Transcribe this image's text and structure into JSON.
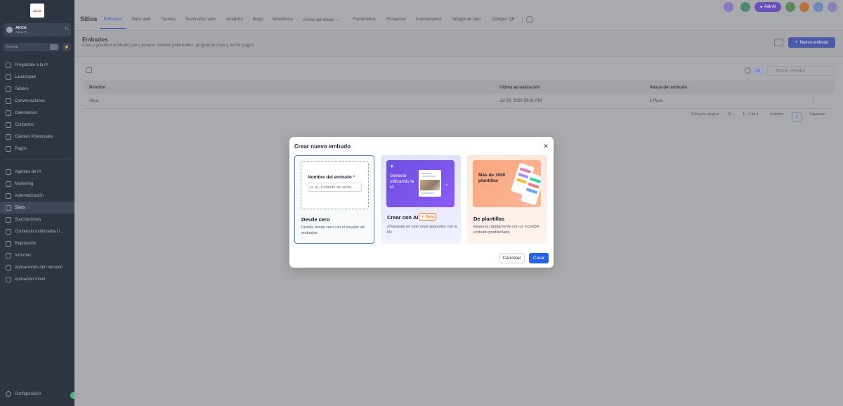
{
  "sidebar": {
    "logo_text": "AKCA",
    "account": {
      "name": "AKCA",
      "location": "Akca, FL"
    },
    "search_placeholder": "Buscar",
    "items": [
      {
        "label": "Pregúntale a la IA",
        "icon": "sparkle-icon"
      },
      {
        "label": "Launchpad",
        "icon": "rocket-icon"
      },
      {
        "label": "Tablero",
        "icon": "dashboard-icon"
      },
      {
        "label": "Conversaciones",
        "icon": "chat-icon"
      },
      {
        "label": "Calendarios",
        "icon": "calendar-icon"
      },
      {
        "label": "Contactos",
        "icon": "contacts-icon"
      },
      {
        "label": "Clientes Potenciales",
        "icon": "leads-icon"
      },
      {
        "label": "Pagos",
        "icon": "payments-icon"
      },
      {
        "label": "Agentes de IA",
        "icon": "robot-icon"
      },
      {
        "label": "Marketing",
        "icon": "megaphone-icon"
      },
      {
        "label": "Automatización",
        "icon": "automation-icon"
      },
      {
        "label": "Sitios",
        "icon": "globe-icon"
      },
      {
        "label": "Suscripciones",
        "icon": "subscription-icon"
      },
      {
        "label": "Contenido multimedia U...",
        "icon": "media-icon"
      },
      {
        "label": "Reputación",
        "icon": "star-icon"
      },
      {
        "label": "Informes",
        "icon": "chart-icon"
      },
      {
        "label": "Aplicaciones del mercado",
        "icon": "apps-icon"
      },
      {
        "label": "Aplicación móvil",
        "icon": "mobile-icon"
      }
    ],
    "settings_label": "Configuración"
  },
  "topbar": {
    "title": "Sitios",
    "tabs": [
      "Embudos",
      "Sitios web",
      "Tiendas",
      "Seminarios web",
      "Analytics",
      "Blogs",
      "WordPress",
      "Portal del cliente",
      "Formularios",
      "Encuestas",
      "Cuestionarios",
      "Widget de chat",
      "Códigos QR"
    ],
    "ask_ai": "Ask AI"
  },
  "page": {
    "title": "Embudos",
    "subtitle": "Cree y gestione embudos para generar clientes potenciales, programar citas y recibir pagos.",
    "new_button": "Nuevo embudo",
    "count": "10",
    "search_placeholder": "Buscar embudos"
  },
  "table": {
    "headers": [
      "Nombre",
      "Última actualización",
      "Pasos del embudo"
    ],
    "rows": [
      {
        "name": "Akca",
        "updated": "Jul 09, 2026 09:41 PM",
        "steps": "1 Paso"
      }
    ],
    "rows_per_page_label": "Filas por página",
    "rows_per_page": "15",
    "range": "1 - 1 de 1",
    "prev": "Anterior",
    "page": "1",
    "next": "Siguiente"
  },
  "modal": {
    "title": "Crear nuevo embudo",
    "options": [
      {
        "title": "Desde cero",
        "desc": "Diseña desde cero con el creador de embudos.",
        "field_label": "Nombre del embudo",
        "field_required": "*",
        "field_placeholder": "p. ej., Embudo de venta"
      },
      {
        "title": "Crear con AI",
        "badge": "Beta",
        "desc": "¡Prepáralo en solo unos segundos con la IA!",
        "card_text": "Generar utilizando la IA"
      },
      {
        "title": "De plantillas",
        "desc": "Empieza rápidamente con un increíble embudo prediseñado",
        "card_text": "Más de 1000 plantillas"
      }
    ],
    "cancel": "Cancelar",
    "create": "Crear"
  },
  "colors": {
    "accent": "#2563eb",
    "selected_border": "#3b82f6",
    "beta": "#ea580c"
  }
}
